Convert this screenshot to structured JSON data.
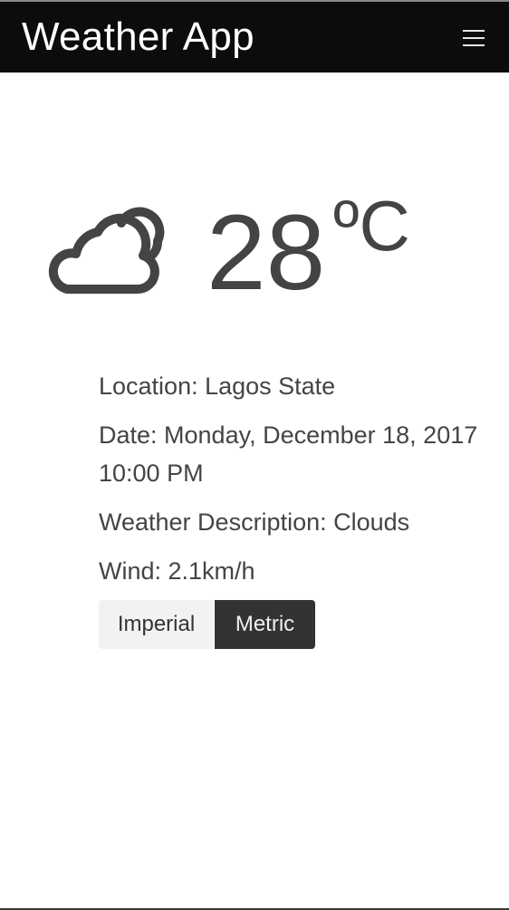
{
  "navbar": {
    "brand": "Weather App",
    "menu_icon": "hamburger-menu-icon"
  },
  "current": {
    "icon": "cloud-icon",
    "temperature": "28",
    "unit_symbol": "ºC"
  },
  "details": {
    "location": "Location: Lagos State",
    "date": "Date: Monday, December 18, 2017 10:00 PM",
    "description": "Weather Description: Clouds",
    "wind": "Wind: 2.1km/h"
  },
  "units": {
    "imperial_label": "Imperial",
    "metric_label": "Metric",
    "selected": "Metric"
  },
  "colors": {
    "navbar_bg": "#0c0c0c",
    "text": "#444444",
    "active_button": "#333333",
    "inactive_button": "#f2f2f2"
  }
}
